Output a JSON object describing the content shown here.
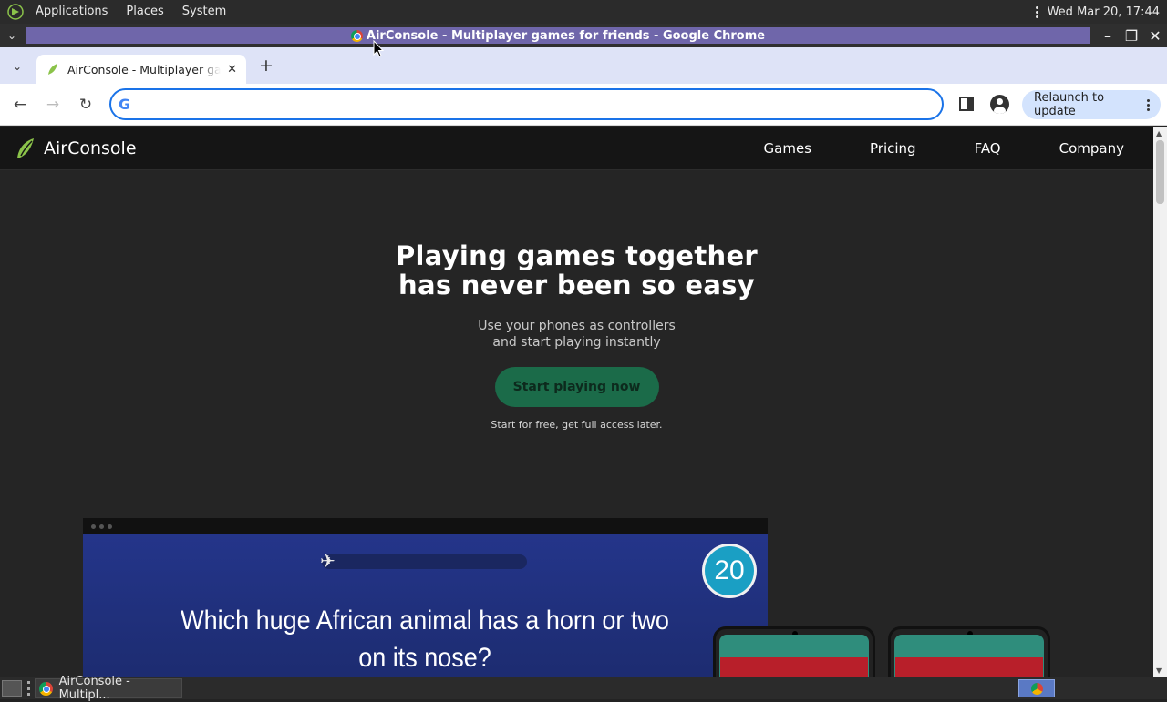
{
  "top_panel": {
    "menus": [
      "Applications",
      "Places",
      "System"
    ],
    "clock": "Wed Mar 20, 17:44"
  },
  "window": {
    "title": "AirConsole - Multiplayer games for friends - Google Chrome"
  },
  "browser": {
    "tab_title": "AirConsole - Multiplayer games for friends",
    "omnibox_value": "",
    "relaunch_label": "Relaunch to update"
  },
  "site": {
    "brand": "AirConsole",
    "nav": [
      "Games",
      "Pricing",
      "FAQ",
      "Company"
    ],
    "hero_line1": "Playing games together",
    "hero_line2": "has never been so easy",
    "sub_line1": "Use your phones as controllers",
    "sub_line2": "and start playing instantly",
    "cta": "Start playing now",
    "cta_note": "Start for free, get full access later."
  },
  "game_preview": {
    "timer": "20",
    "question": "Which huge African animal has a horn or two on its nose?"
  },
  "taskbar": {
    "task_label": "AirConsole - Multipl..."
  },
  "colors": {
    "accent_green": "#1b6b49",
    "title_highlight": "#6f66aa",
    "omnibox_focus": "#1a73e8"
  }
}
